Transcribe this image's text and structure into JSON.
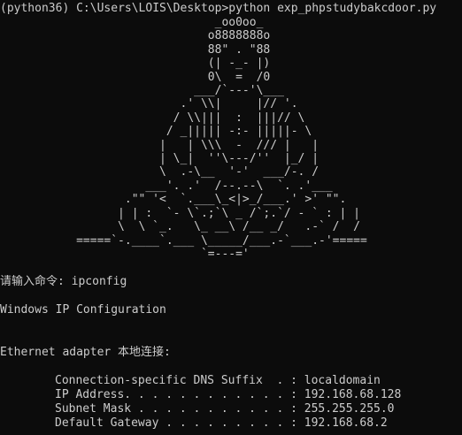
{
  "prompt": {
    "env": "(python36)",
    "path": "C:\\Users\\LOIS\\Desktop>",
    "command": "python exp_phpstudybakcdoor.py"
  },
  "ascii_art": "                               _oo0oo_\n                              o8888888o\n                              88\" . \"88\n                              (| -_- |)\n                              0\\  =  /0\n                            ___/`---'\\___\n                          .' \\\\|     |// '.\n                         / \\\\|||  :  |||// \\\n                        / _||||| -:- |||||- \\\n                       |   | \\\\\\  -  /// |   |\n                       | \\_|  ''\\---/''  |_/ |\n                       \\  .-\\__  '-'  ___/-. /\n                     ___'. .'  /--.--\\  `. .'___\n                  .\"\" '<  `.___\\_<|>_/___.' >' \"\".\n                 | | :  `- \\`.;`\\ _ /`;.`/ - ` : | |\n                 \\  \\ `_.   \\_ __\\ /__ _/   .-` /  /\n           =====`-.____`.___ \\_____/___.-`___.-'=====\n                             `=---='",
  "input_prompt": "请输入命令:",
  "input_value": "ipconfig",
  "header": "Windows IP Configuration",
  "adapter": "Ethernet adapter 本地连接:",
  "config_rows": [
    {
      "label": "Connection-specific DNS Suffix  . : ",
      "value": "localdomain"
    },
    {
      "label": "IP Address. . . . . . . . . . . . : ",
      "value": "192.168.68.128"
    },
    {
      "label": "Subnet Mask . . . . . . . . . . . : ",
      "value": "255.255.255.0"
    },
    {
      "label": "Default Gateway . . . . . . . . . : ",
      "value": "192.168.68.2"
    }
  ],
  "colors": {
    "background": "#0c0c0c",
    "foreground": "#cccccc"
  }
}
